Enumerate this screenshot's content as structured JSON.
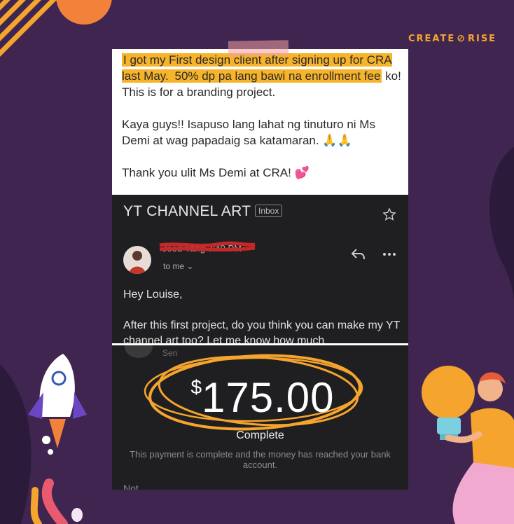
{
  "brand": {
    "name_left": "CREATE",
    "name_right": "RISE"
  },
  "post": {
    "para1_plain_a": "I got my First design client after signing up for CRA last May. ",
    "para1_highlight": "50% dp pa lang bawi na enrollment fee",
    "para1_plain_b": " ko! This is for a branding project.",
    "para2": "Kaya guys!! Isapuso lang lahat ng tinuturo ni Ms Demi at wag papadaig sa katamaran. 🙏🙏",
    "para3": "Thank you ulit Ms Demi at CRA! 💕"
  },
  "email": {
    "subject": "YT CHANNEL ART",
    "badge": "Inbox",
    "sender": "Jood Yang 3:40 PM",
    "recipient": "to me ⌄",
    "greeting": "Hey Louise,",
    "body": "After this first project, do you think you can make my YT channel art too? Let me know how much"
  },
  "payment": {
    "partial_text": "Sen",
    "currency": "$",
    "amount": "175.00",
    "status": "Complete",
    "note": "This payment is complete and the money has reached your bank account.",
    "note_label": "Not"
  },
  "colors": {
    "background": "#3f2550",
    "accent": "#f5a52e",
    "highlight": "#f7b32a"
  },
  "icons": [
    "star-icon",
    "reply-icon",
    "more-icon",
    "rocket-illustration",
    "lightbulb-illustration"
  ]
}
